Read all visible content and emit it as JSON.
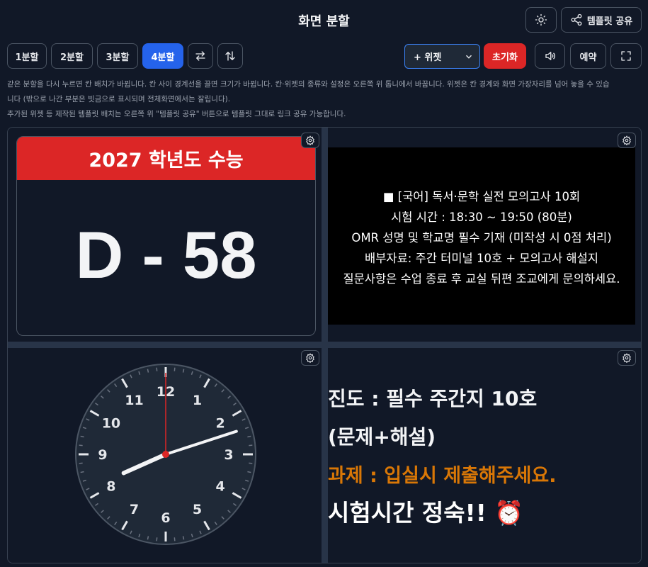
{
  "header": {
    "title": "화면 분할"
  },
  "toolbar": {
    "split_buttons": [
      "1분할",
      "2분할",
      "3분할",
      "4분할"
    ],
    "active_split": "4분할",
    "add_widget_select": "+ 위젯",
    "reset_label": "초기화",
    "schedule_label": "예약",
    "share_template_label": "템플릿 공유"
  },
  "help": {
    "line1": "같은 분할을 다시 누르면 칸 배치가 바뀝니다. 칸 사이 경계선을 끌면 크기가 바뀝니다. 칸·위젯의 종류와 설정은 오른쪽 위 톱니에서 바꿉니다. 위젯은 칸 경계와 화면 가장자리를 넘어 놓을 수 있습",
    "line2": "니다 (밖으로 나간 부분은 빗금으로 표시되며 전체화면에서는 잘립니다).",
    "line3": "추가된 위젯 등 제작된 템플릿 배치는 오른쪽 위 \"템플릿 공유\" 버튼으로 템플릿 그대로 링크 공유 가능합니다."
  },
  "dday": {
    "title": "2027 학년도 수능",
    "value": "D - 58"
  },
  "notice": {
    "lines": [
      "■ [국어] 독서·문학 실전 모의고사 10회",
      "시험 시간 : 18:30 ~ 19:50 (80분)",
      "OMR 성명 및 학교명 필수 기재 (미작성 시 0점 처리)",
      "배부자료: 주간 터미널 10호 + 모의고사 해설지",
      "질문사항은 수업 종료 후 교실 뒤편 조교에게 문의하세요."
    ]
  },
  "memo": {
    "line1": "진도 : 필수 주간지 10호",
    "line2": "(문제+해설)",
    "line3": "과제 : 입실시 제출해주세요.",
    "line4": "시험시간 정숙!! ⏰"
  },
  "clock": {
    "numbers": [
      "12",
      "1",
      "2",
      "3",
      "4",
      "5",
      "6",
      "7",
      "8",
      "9",
      "10",
      "11"
    ],
    "time": {
      "hour": 8,
      "minute": 12,
      "second": 0
    }
  },
  "colors": {
    "accent": "#2563eb",
    "danger": "#dc2626",
    "warning": "#d97706",
    "background": "#111827"
  }
}
